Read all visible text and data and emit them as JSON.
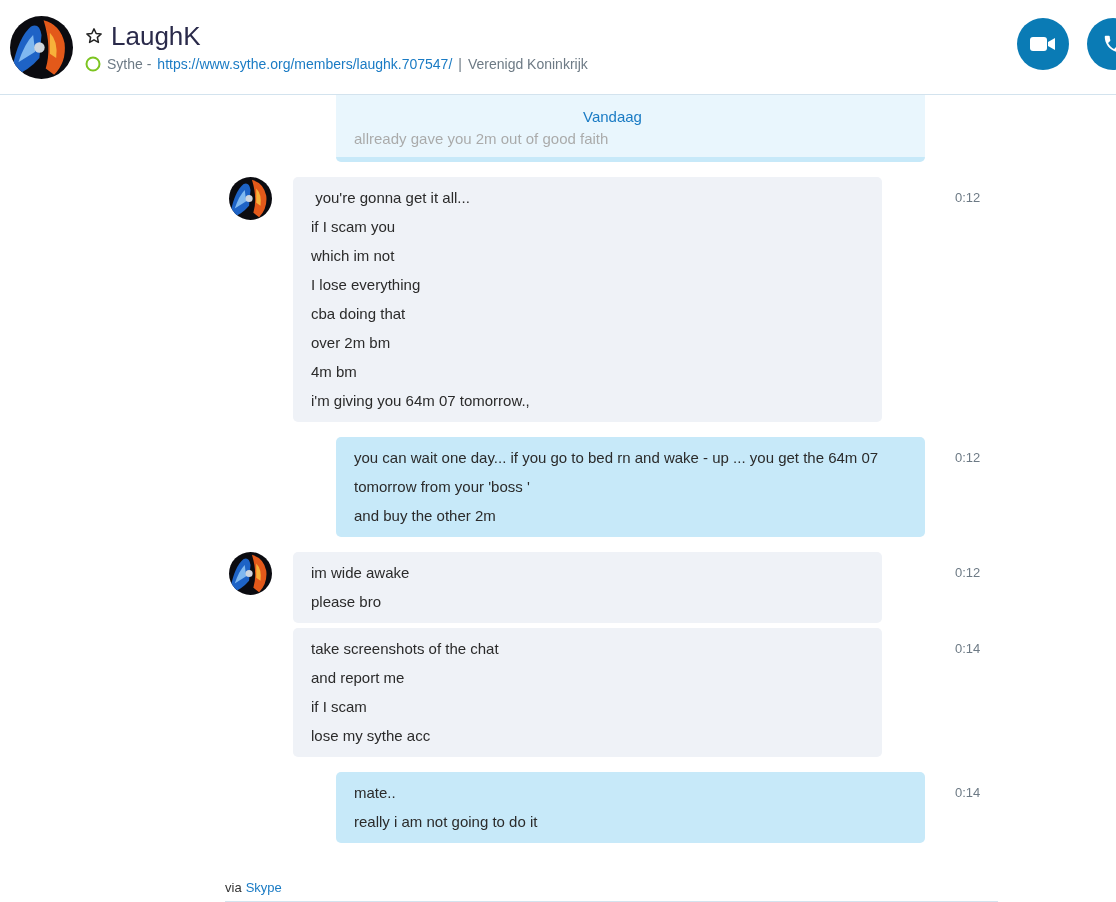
{
  "header": {
    "name": "LaughK",
    "subtitle": {
      "prefix": "Sythe -",
      "link": "https://www.sythe.org/members/laughk.707547/",
      "separator": "|",
      "location": "Verenigd Koninkrijk"
    }
  },
  "date_divider": "Vandaag",
  "messages": [
    {
      "kind": "outgoing",
      "covered": true,
      "avatar": false,
      "lines": [
        "allready gave you 2m out of good faith"
      ]
    },
    {
      "kind": "incoming",
      "covered": false,
      "avatar": true,
      "time": "0:12",
      "lines": [
        " you're gonna get it all...",
        "if I scam you",
        "which im not",
        "I lose everything",
        "cba doing that",
        "over 2m bm",
        "4m bm",
        "i'm giving you 64m 07 tomorrow.,"
      ]
    },
    {
      "kind": "outgoing",
      "covered": false,
      "avatar": false,
      "time": "0:12",
      "lines": [
        "you can wait one day... if you go to bed rn and wake - up ... you get the 64m 07 tomorrow from your 'boss '",
        "and buy the other 2m"
      ]
    },
    {
      "kind": "incoming",
      "covered": false,
      "avatar": true,
      "time": "0:12",
      "lines": [
        "im wide awake",
        "please bro"
      ]
    },
    {
      "kind": "incoming",
      "covered": false,
      "avatar": false,
      "time": "0:14",
      "lines": [
        "take screenshots of the chat",
        "and report me",
        "if I scam",
        "lose my sythe acc"
      ]
    },
    {
      "kind": "outgoing",
      "covered": false,
      "avatar": false,
      "time": "0:14",
      "lines": [
        "mate..",
        "really i am not going to do it"
      ]
    }
  ],
  "footer": {
    "prefix": "via",
    "link": "Skype"
  }
}
